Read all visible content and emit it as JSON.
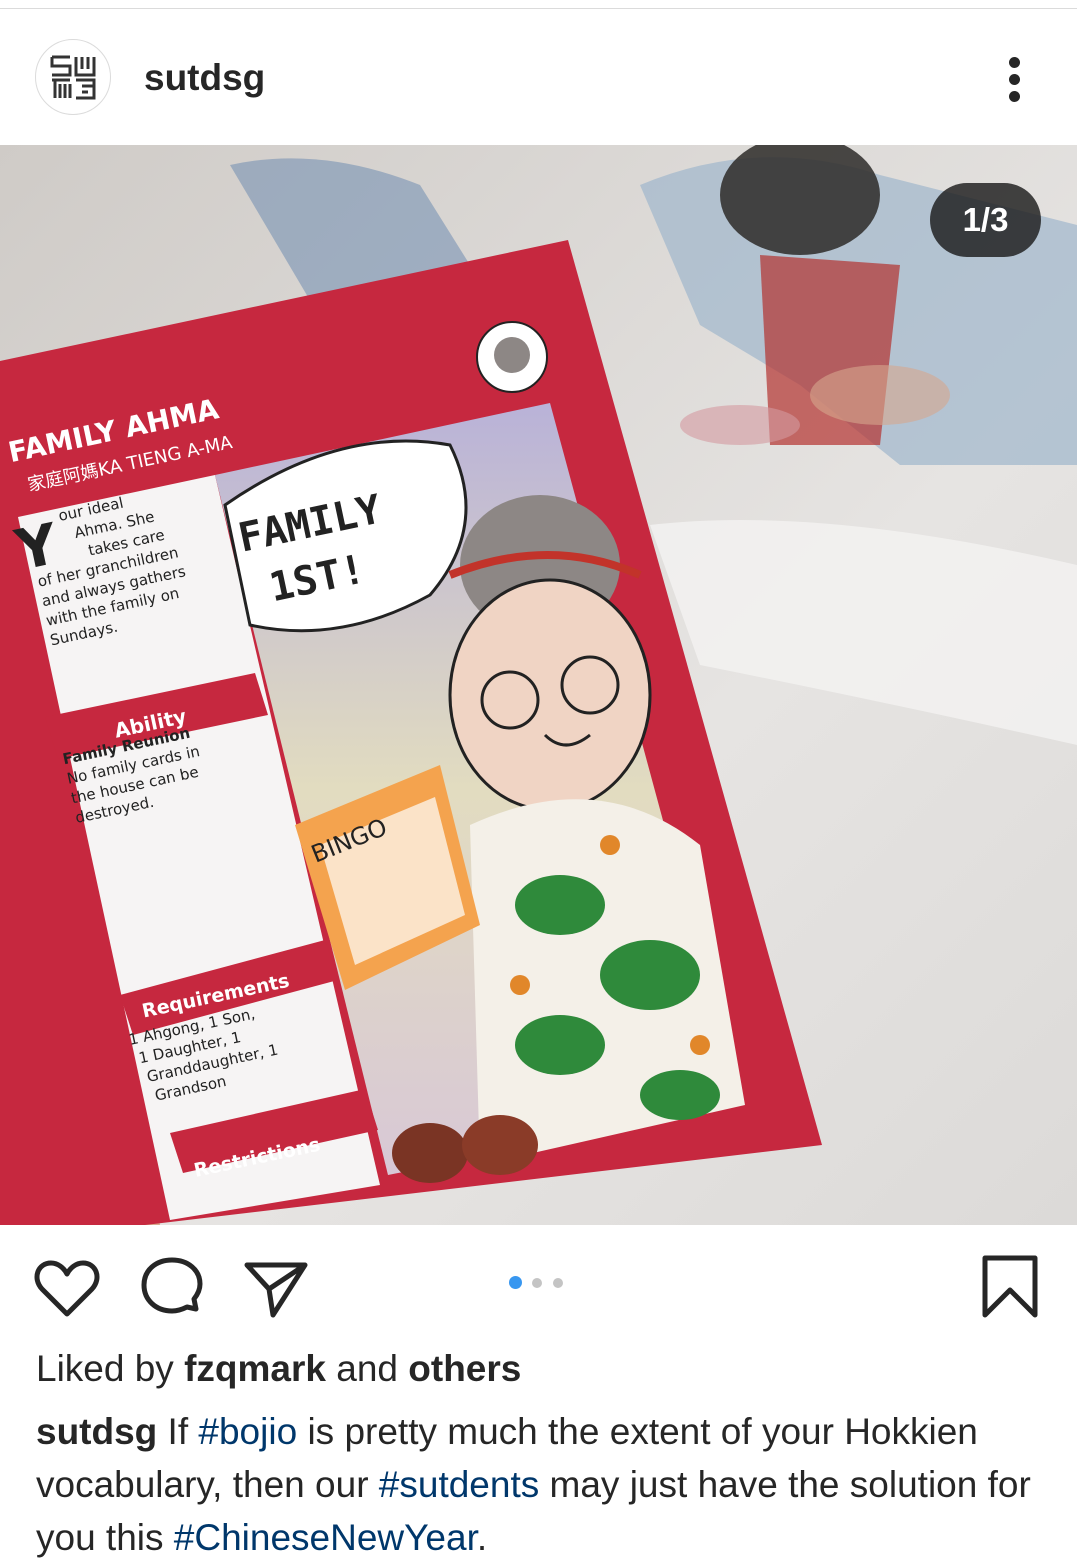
{
  "post": {
    "username": "sutdsg",
    "counter": "1/3",
    "slides": {
      "current": 1,
      "total": 3
    }
  },
  "photo_text": {
    "card_title": "FAMILY AHMA",
    "card_subtitle": "家庭阿媽KA TIENG A-MA",
    "description_lines": [
      "our ideal",
      "Ahma. She",
      "takes care",
      "of her granchildren",
      "and always gathers",
      "with the family on",
      "Sundays."
    ],
    "ability_label": "Ability",
    "ability_lines": [
      "Family Reunion",
      "No family cards in",
      "the house can be",
      "destroyed."
    ],
    "requirements_label": "Requirements",
    "requirements_lines": [
      "1 Ahgong, 1 Son,",
      "1 Daughter, 1",
      "Granddaughter, 1",
      "Grandson"
    ],
    "restrictions_label": "Restrictions",
    "speech_line1": "FAMILY",
    "speech_line2": "1ST!",
    "bingo": "BINGO"
  },
  "likes": {
    "prefix": "Liked by ",
    "user": "fzqmark",
    "middle": " and ",
    "others": "others"
  },
  "caption": {
    "user": "sutdsg",
    "t1": " If ",
    "tag1": "#bojio",
    "t2": " is pretty much the extent of your Hokkien vocabulary, then our ",
    "tag2": "#sutdents",
    "t3": " may just have the solution for you this ",
    "tag3": "#ChineseNewYear",
    "t4": "."
  },
  "icons": [
    "sutd-logo-icon",
    "more-options-icon",
    "heart-icon",
    "comment-icon",
    "share-icon",
    "bookmark-icon"
  ],
  "colors": {
    "accent": "#3897f0",
    "hashtag": "#00376b",
    "card_red": "#c6283f"
  }
}
